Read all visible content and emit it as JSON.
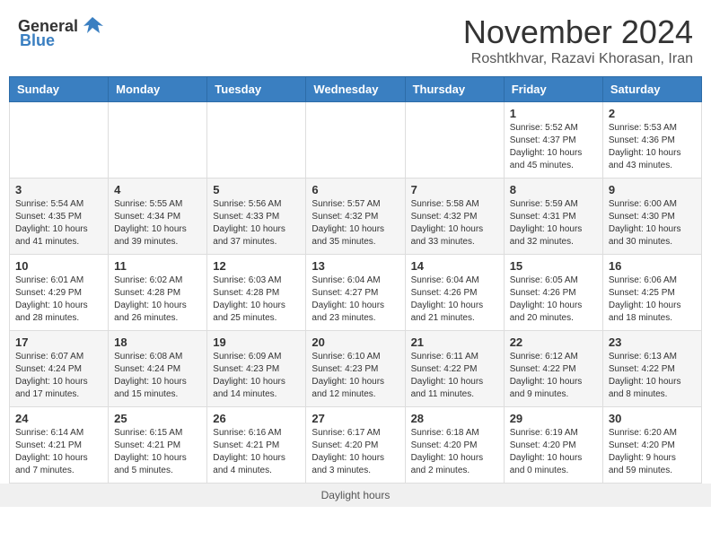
{
  "header": {
    "logo_general": "General",
    "logo_blue": "Blue",
    "month_year": "November 2024",
    "location": "Roshtkhvar, Razavi Khorasan, Iran"
  },
  "days_of_week": [
    "Sunday",
    "Monday",
    "Tuesday",
    "Wednesday",
    "Thursday",
    "Friday",
    "Saturday"
  ],
  "weeks": [
    {
      "days": [
        {
          "date": "",
          "info": ""
        },
        {
          "date": "",
          "info": ""
        },
        {
          "date": "",
          "info": ""
        },
        {
          "date": "",
          "info": ""
        },
        {
          "date": "",
          "info": ""
        },
        {
          "date": "1",
          "info": "Sunrise: 5:52 AM\nSunset: 4:37 PM\nDaylight: 10 hours\nand 45 minutes."
        },
        {
          "date": "2",
          "info": "Sunrise: 5:53 AM\nSunset: 4:36 PM\nDaylight: 10 hours\nand 43 minutes."
        }
      ]
    },
    {
      "days": [
        {
          "date": "3",
          "info": "Sunrise: 5:54 AM\nSunset: 4:35 PM\nDaylight: 10 hours\nand 41 minutes."
        },
        {
          "date": "4",
          "info": "Sunrise: 5:55 AM\nSunset: 4:34 PM\nDaylight: 10 hours\nand 39 minutes."
        },
        {
          "date": "5",
          "info": "Sunrise: 5:56 AM\nSunset: 4:33 PM\nDaylight: 10 hours\nand 37 minutes."
        },
        {
          "date": "6",
          "info": "Sunrise: 5:57 AM\nSunset: 4:32 PM\nDaylight: 10 hours\nand 35 minutes."
        },
        {
          "date": "7",
          "info": "Sunrise: 5:58 AM\nSunset: 4:32 PM\nDaylight: 10 hours\nand 33 minutes."
        },
        {
          "date": "8",
          "info": "Sunrise: 5:59 AM\nSunset: 4:31 PM\nDaylight: 10 hours\nand 32 minutes."
        },
        {
          "date": "9",
          "info": "Sunrise: 6:00 AM\nSunset: 4:30 PM\nDaylight: 10 hours\nand 30 minutes."
        }
      ]
    },
    {
      "days": [
        {
          "date": "10",
          "info": "Sunrise: 6:01 AM\nSunset: 4:29 PM\nDaylight: 10 hours\nand 28 minutes."
        },
        {
          "date": "11",
          "info": "Sunrise: 6:02 AM\nSunset: 4:28 PM\nDaylight: 10 hours\nand 26 minutes."
        },
        {
          "date": "12",
          "info": "Sunrise: 6:03 AM\nSunset: 4:28 PM\nDaylight: 10 hours\nand 25 minutes."
        },
        {
          "date": "13",
          "info": "Sunrise: 6:04 AM\nSunset: 4:27 PM\nDaylight: 10 hours\nand 23 minutes."
        },
        {
          "date": "14",
          "info": "Sunrise: 6:04 AM\nSunset: 4:26 PM\nDaylight: 10 hours\nand 21 minutes."
        },
        {
          "date": "15",
          "info": "Sunrise: 6:05 AM\nSunset: 4:26 PM\nDaylight: 10 hours\nand 20 minutes."
        },
        {
          "date": "16",
          "info": "Sunrise: 6:06 AM\nSunset: 4:25 PM\nDaylight: 10 hours\nand 18 minutes."
        }
      ]
    },
    {
      "days": [
        {
          "date": "17",
          "info": "Sunrise: 6:07 AM\nSunset: 4:24 PM\nDaylight: 10 hours\nand 17 minutes."
        },
        {
          "date": "18",
          "info": "Sunrise: 6:08 AM\nSunset: 4:24 PM\nDaylight: 10 hours\nand 15 minutes."
        },
        {
          "date": "19",
          "info": "Sunrise: 6:09 AM\nSunset: 4:23 PM\nDaylight: 10 hours\nand 14 minutes."
        },
        {
          "date": "20",
          "info": "Sunrise: 6:10 AM\nSunset: 4:23 PM\nDaylight: 10 hours\nand 12 minutes."
        },
        {
          "date": "21",
          "info": "Sunrise: 6:11 AM\nSunset: 4:22 PM\nDaylight: 10 hours\nand 11 minutes."
        },
        {
          "date": "22",
          "info": "Sunrise: 6:12 AM\nSunset: 4:22 PM\nDaylight: 10 hours\nand 9 minutes."
        },
        {
          "date": "23",
          "info": "Sunrise: 6:13 AM\nSunset: 4:22 PM\nDaylight: 10 hours\nand 8 minutes."
        }
      ]
    },
    {
      "days": [
        {
          "date": "24",
          "info": "Sunrise: 6:14 AM\nSunset: 4:21 PM\nDaylight: 10 hours\nand 7 minutes."
        },
        {
          "date": "25",
          "info": "Sunrise: 6:15 AM\nSunset: 4:21 PM\nDaylight: 10 hours\nand 5 minutes."
        },
        {
          "date": "26",
          "info": "Sunrise: 6:16 AM\nSunset: 4:21 PM\nDaylight: 10 hours\nand 4 minutes."
        },
        {
          "date": "27",
          "info": "Sunrise: 6:17 AM\nSunset: 4:20 PM\nDaylight: 10 hours\nand 3 minutes."
        },
        {
          "date": "28",
          "info": "Sunrise: 6:18 AM\nSunset: 4:20 PM\nDaylight: 10 hours\nand 2 minutes."
        },
        {
          "date": "29",
          "info": "Sunrise: 6:19 AM\nSunset: 4:20 PM\nDaylight: 10 hours\nand 0 minutes."
        },
        {
          "date": "30",
          "info": "Sunrise: 6:20 AM\nSunset: 4:20 PM\nDaylight: 9 hours\nand 59 minutes."
        }
      ]
    }
  ],
  "footer": {
    "daylight_label": "Daylight hours"
  }
}
